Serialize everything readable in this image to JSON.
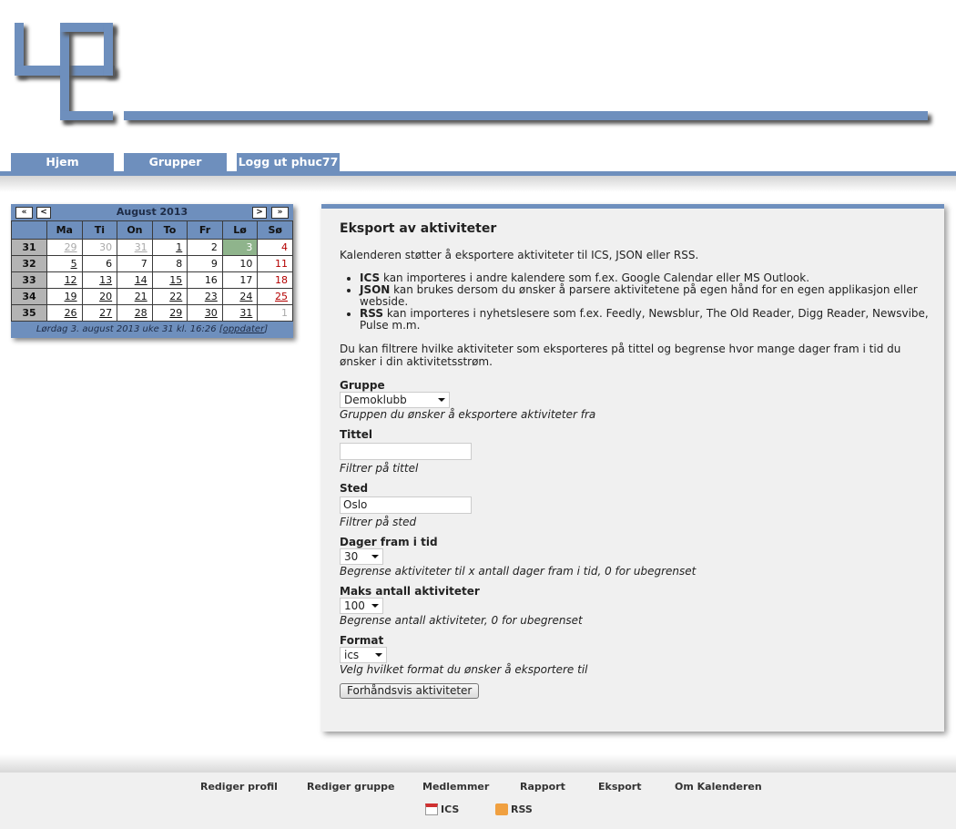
{
  "nav": {
    "tabs": [
      {
        "label": "Hjem"
      },
      {
        "label": "Grupper"
      },
      {
        "label": "Logg ut phuc77"
      }
    ]
  },
  "calendar": {
    "nav": {
      "first": "«",
      "prev": "<",
      "next": ">",
      "last": "»"
    },
    "title": "August 2013",
    "weekdays": [
      "Ma",
      "Ti",
      "On",
      "To",
      "Fr",
      "Lø",
      "Sø"
    ],
    "weeks": [
      {
        "week": "31",
        "days": [
          "29",
          "30",
          "31",
          "1",
          "2",
          "3",
          "4"
        ]
      },
      {
        "week": "32",
        "days": [
          "5",
          "6",
          "7",
          "8",
          "9",
          "10",
          "11"
        ]
      },
      {
        "week": "33",
        "days": [
          "12",
          "13",
          "14",
          "15",
          "16",
          "17",
          "18"
        ]
      },
      {
        "week": "34",
        "days": [
          "19",
          "20",
          "21",
          "22",
          "23",
          "24",
          "25"
        ]
      },
      {
        "week": "35",
        "days": [
          "26",
          "27",
          "28",
          "29",
          "30",
          "31",
          "1"
        ]
      }
    ],
    "footer_text": "Lørdag 3. august 2013 uke 31 kl. 16:26",
    "update_link": "oppdater",
    "colors": {
      "header": "#6e8fbd",
      "today": "#8fb48c",
      "sunday": "#b40000"
    }
  },
  "main": {
    "title": "Eksport av aktiviteter",
    "intro": "Kalenderen støtter å eksportere aktiviteter til ICS, JSON eller RSS.",
    "formats": [
      {
        "name": "ICS",
        "text": " kan importeres i andre kalendere som f.ex. Google Calendar eller MS Outlook."
      },
      {
        "name": "JSON",
        "text": " kan brukes dersom du ønsker å parsere aktivitetene på egen hånd for en egen applikasjon eller webside."
      },
      {
        "name": "RSS",
        "text": " kan importeres i nyhetslesere som f.ex. Feedly, Newsblur, The Old Reader, Digg Reader, Newsvibe, Pulse m.m."
      }
    ],
    "filter_text": "Du kan filtrere hvilke aktiviteter som eksporteres på tittel og begrense hvor mange dager fram i tid du ønsker i din aktivitetsstrøm.",
    "fields": {
      "group": {
        "label": "Gruppe",
        "value": "Demoklubb",
        "help": "Gruppen du ønsker å eksportere aktiviteter fra"
      },
      "title": {
        "label": "Tittel",
        "value": "",
        "help": "Filtrer på tittel"
      },
      "place": {
        "label": "Sted",
        "value": "Oslo",
        "help": "Filtrer på sted"
      },
      "days": {
        "label": "Dager fram i tid",
        "value": "30",
        "help": "Begrense aktiviteter til x antall dager fram i tid, 0 for ubegrenset"
      },
      "max": {
        "label": "Maks antall aktiviteter",
        "value": "100",
        "help": "Begrense antall aktiviteter, 0 for ubegrenset"
      },
      "format": {
        "label": "Format",
        "value": "ics",
        "help": "Velg hvilket format du ønsker å eksportere til"
      }
    },
    "preview_button": "Forhåndsvis aktiviteter"
  },
  "footer": {
    "links": [
      "Rediger profil",
      "Rediger gruppe",
      "Medlemmer",
      "Rapport",
      "Eksport",
      "Om Kalenderen"
    ],
    "feeds": [
      {
        "label": "ICS",
        "icon": "calendar-icon"
      },
      {
        "label": "RSS",
        "icon": "rss-icon"
      }
    ]
  },
  "colors": {
    "accent": "#6e8fbd",
    "panel_bg": "#f0f0f0"
  }
}
